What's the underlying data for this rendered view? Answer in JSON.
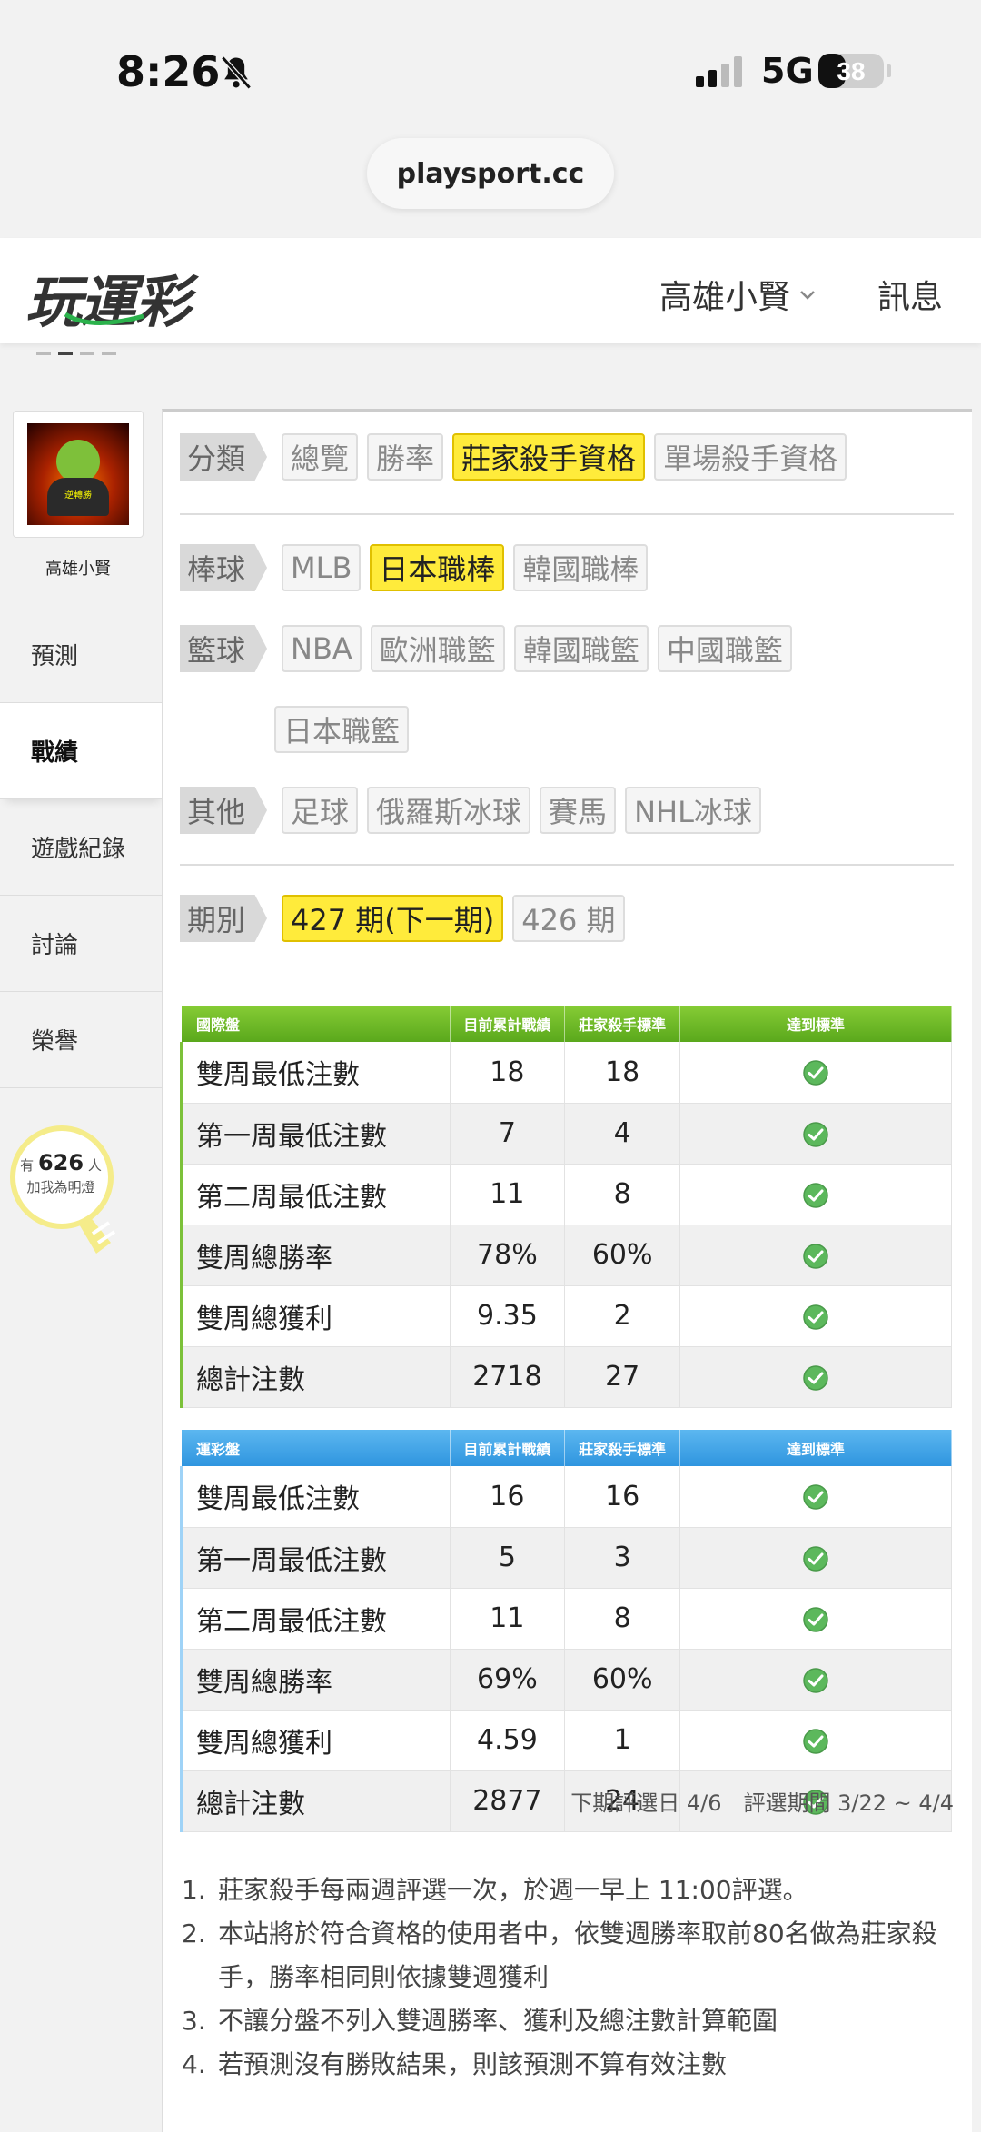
{
  "status": {
    "time": "8:26",
    "network": "5G",
    "battery": "38"
  },
  "browser": {
    "url": "playsport.cc"
  },
  "header": {
    "logo": "玩運彩",
    "user": "高雄小賢",
    "messages": "訊息"
  },
  "sidebar": {
    "avatar_name": "高雄小賢",
    "avatar_tag": "逆轉勝",
    "items": [
      {
        "label": "預測"
      },
      {
        "label": "戰績"
      },
      {
        "label": "遊戲紀錄"
      },
      {
        "label": "討論"
      },
      {
        "label": "榮譽"
      }
    ],
    "bulb": {
      "prefix": "有",
      "count": "626",
      "suffix": "人",
      "text": "加我為明燈"
    }
  },
  "filters": {
    "category": {
      "label": "分類",
      "options": [
        "總覽",
        "勝率",
        "莊家殺手資格",
        "單場殺手資格"
      ],
      "selected": "莊家殺手資格"
    },
    "baseball": {
      "label": "棒球",
      "options": [
        "MLB",
        "日本職棒",
        "韓國職棒"
      ],
      "selected": "日本職棒"
    },
    "basketball": {
      "label": "籃球",
      "options": [
        "NBA",
        "歐洲職籃",
        "韓國職籃",
        "中國職籃",
        "日本職籃"
      ]
    },
    "other": {
      "label": "其他",
      "options": [
        "足球",
        "俄羅斯冰球",
        "賽馬",
        "NHL冰球"
      ]
    },
    "period": {
      "label": "期別",
      "options": [
        "427 期(下一期)",
        "426 期"
      ],
      "selected": "427 期(下一期)"
    }
  },
  "tables": [
    {
      "title": "國際盤",
      "headers": [
        "目前累計戰績",
        "莊家殺手標準",
        "達到標準"
      ],
      "rows": [
        {
          "label": "雙周最低注數",
          "current": "18",
          "standard": "18",
          "met": true
        },
        {
          "label": "第一周最低注數",
          "current": "7",
          "standard": "4",
          "met": true
        },
        {
          "label": "第二周最低注數",
          "current": "11",
          "standard": "8",
          "met": true
        },
        {
          "label": "雙周總勝率",
          "current": "78%",
          "standard": "60%",
          "met": true
        },
        {
          "label": "雙周總獲利",
          "current": "9.35",
          "standard": "2",
          "met": true
        },
        {
          "label": "總計注數",
          "current": "2718",
          "standard": "27",
          "met": true
        }
      ]
    },
    {
      "title": "運彩盤",
      "headers": [
        "目前累計戰績",
        "莊家殺手標準",
        "達到標準"
      ],
      "rows": [
        {
          "label": "雙周最低注數",
          "current": "16",
          "standard": "16",
          "met": true
        },
        {
          "label": "第一周最低注數",
          "current": "5",
          "standard": "3",
          "met": true
        },
        {
          "label": "第二周最低注數",
          "current": "11",
          "standard": "8",
          "met": true
        },
        {
          "label": "雙周總勝率",
          "current": "69%",
          "standard": "60%",
          "met": true
        },
        {
          "label": "雙周總獲利",
          "current": "4.59",
          "standard": "1",
          "met": true
        },
        {
          "label": "總計注數",
          "current": "2877",
          "standard": "24",
          "met": true
        }
      ]
    }
  ],
  "period_note": "下期評選日 4/6　評選期間 3/22 ~ 4/4",
  "rules": [
    {
      "num": "1.",
      "text": "莊家殺手每兩週評選一次，於週一早上 11:00評選。"
    },
    {
      "num": "2.",
      "text": "本站將於符合資格的使用者中，依雙週勝率取前80名做為莊家殺手，勝率相同則依據雙週獲利"
    },
    {
      "num": "3.",
      "text": "不讓分盤不列入雙週勝率、獲利及總注數計算範圍"
    },
    {
      "num": "4.",
      "text": "若預測沒有勝敗結果，則該預測不算有效注數"
    }
  ],
  "colors": {
    "accent_yellow": "#ffeb3b",
    "table1_header": "#6cb82a",
    "table2_header": "#3aa0e6",
    "check_green": "#5cb85c"
  }
}
